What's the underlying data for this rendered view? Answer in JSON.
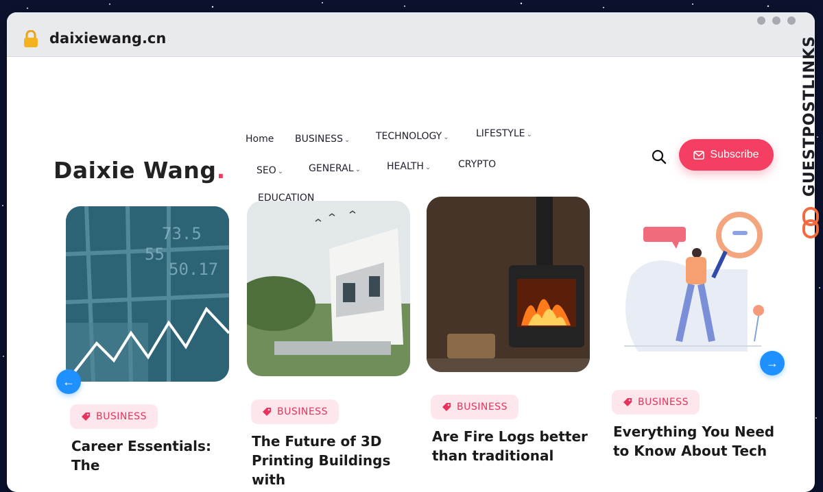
{
  "browser": {
    "url": "daixiewang.cn"
  },
  "site": {
    "logo_text": "Daixie Wang",
    "logo_dot": ".",
    "nav": [
      {
        "label": "Home",
        "dropdown": false
      },
      {
        "label": "BUSINESS",
        "dropdown": true
      },
      {
        "label": "TECHNOLOGY",
        "dropdown": true
      },
      {
        "label": "LIFESTYLE",
        "dropdown": true
      },
      {
        "label": "SEO",
        "dropdown": true
      },
      {
        "label": "GENERAL",
        "dropdown": true
      },
      {
        "label": "HEALTH",
        "dropdown": true
      },
      {
        "label": "CRYPTO",
        "dropdown": false
      },
      {
        "label": "EDUCATION",
        "dropdown": false
      }
    ],
    "subscribe_label": "Subscribe",
    "accent_color": "#f43f62",
    "arrow_prev": "←",
    "arrow_next": "→"
  },
  "cards": [
    {
      "category": "BUSINESS",
      "title": "Career Essentials: The"
    },
    {
      "category": "BUSINESS",
      "title": "The Future of 3D Printing Buildings with"
    },
    {
      "category": "BUSINESS",
      "title": "Are Fire Logs better than traditional"
    },
    {
      "category": "BUSINESS",
      "title": "Everything You Need to Know About Tech"
    }
  ],
  "watermark": {
    "text": "GUESTPOSTLINKS"
  }
}
